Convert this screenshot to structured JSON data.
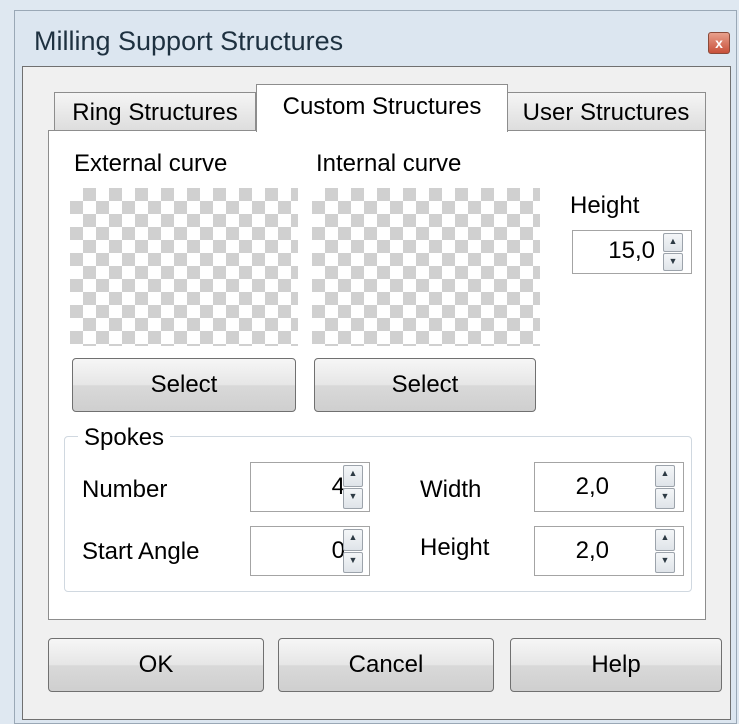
{
  "window": {
    "title": "Milling Support Structures",
    "close_glyph": "x"
  },
  "tabs": [
    {
      "label": "Ring Structures",
      "active": false
    },
    {
      "label": "Custom Structures",
      "active": true
    },
    {
      "label": "User Structures",
      "active": false
    }
  ],
  "custom": {
    "external_label": "External curve",
    "internal_label": "Internal curve",
    "height_label": "Height",
    "height_value": "15,0",
    "select_label_1": "Select",
    "select_label_2": "Select"
  },
  "spokes": {
    "group_label": "Spokes",
    "number_label": "Number",
    "number_value": "4",
    "start_angle_label": "Start Angle",
    "start_angle_value": "0",
    "width_label": "Width",
    "width_value": "2,0",
    "height_label": "Height",
    "height_value": "2,0"
  },
  "buttons": {
    "ok": "OK",
    "cancel": "Cancel",
    "help": "Help"
  },
  "icons": {
    "spin_up": "▲",
    "spin_down": "▼",
    "placeholder_pattern": "checkerboard"
  }
}
